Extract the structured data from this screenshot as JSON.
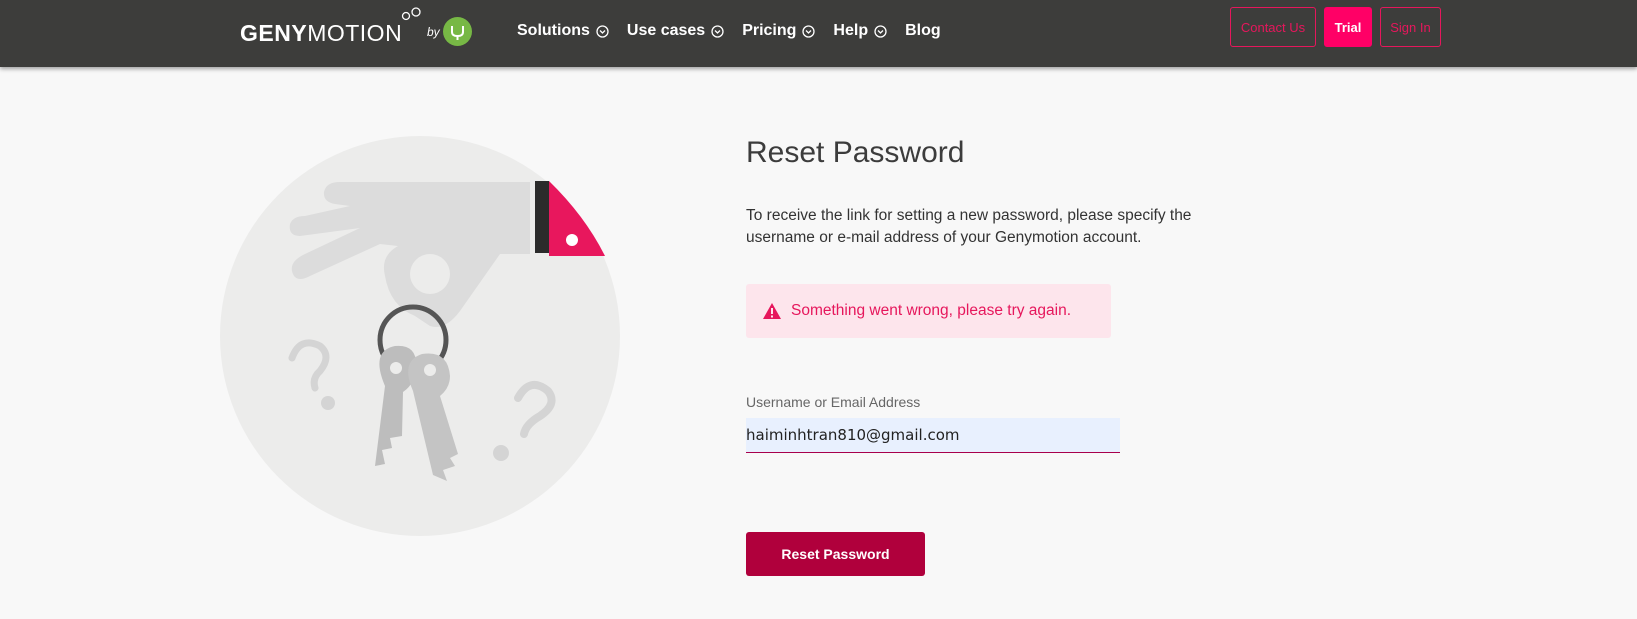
{
  "header": {
    "logo": {
      "part1": "GENY",
      "part2": "MOTION",
      "by": "by"
    },
    "nav": [
      {
        "label": "Solutions",
        "dropdown": true
      },
      {
        "label": "Use cases",
        "dropdown": true
      },
      {
        "label": "Pricing",
        "dropdown": true
      },
      {
        "label": "Help",
        "dropdown": true
      },
      {
        "label": "Blog",
        "dropdown": false
      }
    ],
    "buttons": {
      "contact": "Contact Us",
      "trial": "Trial",
      "signin": "Sign In"
    }
  },
  "main": {
    "title": "Reset Password",
    "description": "To receive the link for setting a new password, please specify the username or e-mail address of your Genymotion account.",
    "alert": {
      "icon": "warning-icon",
      "text": "Something went wrong, please try again."
    },
    "field": {
      "label": "Username or Email Address",
      "value": "haiminhtran810@gmail.com"
    },
    "submit_label": "Reset Password"
  },
  "colors": {
    "header_bg": "#3d3d3b",
    "accent": "#e6175c",
    "button": "#b0003c",
    "logo_badge": "#77b845"
  }
}
